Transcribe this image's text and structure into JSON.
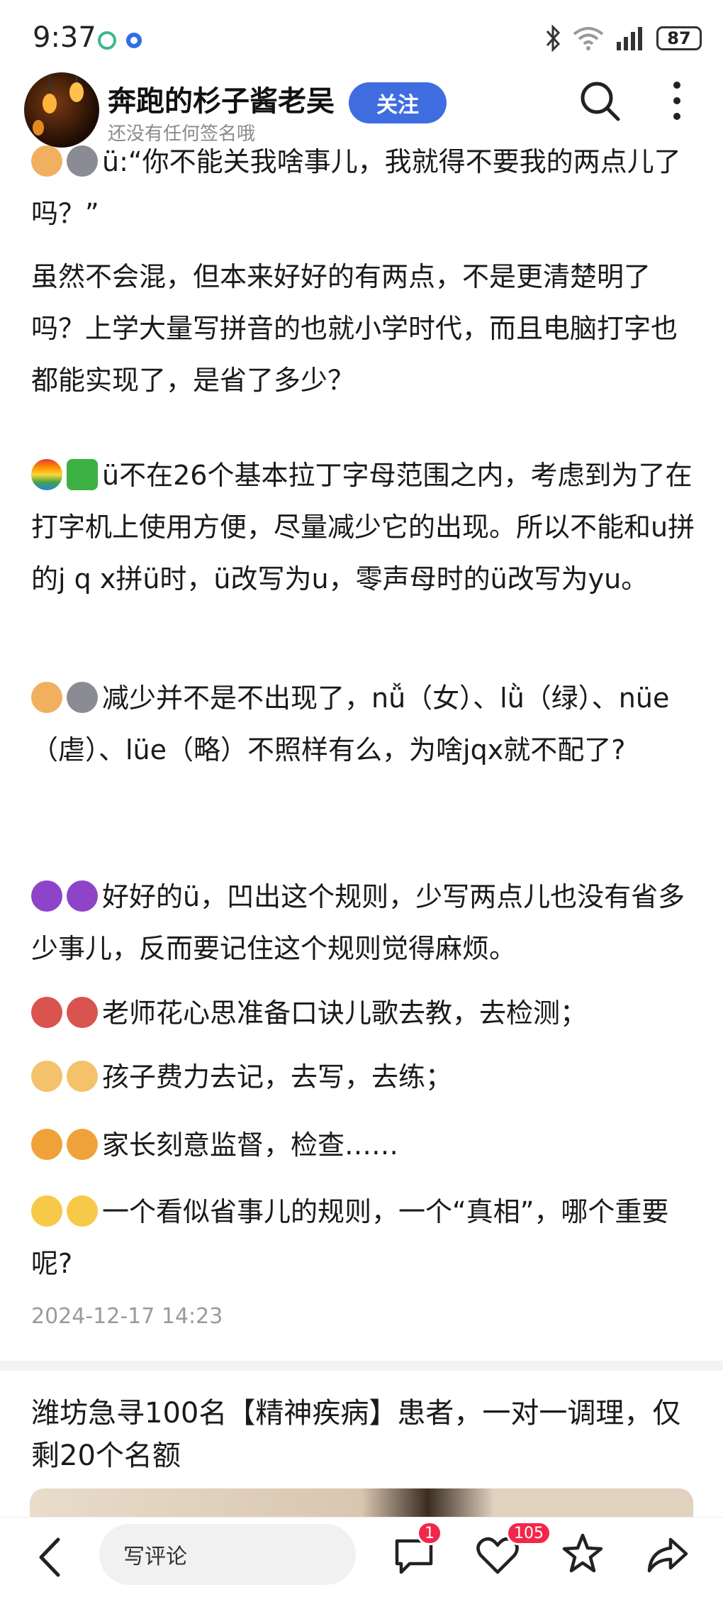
{
  "status": {
    "time": "9:37",
    "battery": "87"
  },
  "header": {
    "author": "奔跑的杉子酱老吴",
    "bio": "还没有任何签名哦",
    "follow_label": "关注"
  },
  "article": {
    "p1": "ü:“你不能关我啥事儿，我就得不要我的两点儿了吗？”",
    "p2": "虽然不会混，但本来好好的有两点，不是更清楚明了吗？上学大量写拼音的也就小学时代，而且电脑打字也都能实现了，是省了多少？",
    "p3": "ü不在26个基本拉丁字母范围之内，考虑到为了在打字机上使用方便，尽量减少它的出现。所以不能和u拼的j q x拼ü时，ü改写为u，零声母时的ü改写为yu。",
    "p4": "减少并不是不出现了，nǚ（女）、lǜ（绿）、nüe（虐）、lüe（略）不照样有么，为啥jqx就不配了?",
    "p5": "好好的ü，凹出这个规则，少写两点儿也没有省多少事儿，反而要记住这个规则觉得麻烦。",
    "p6": "老师花心思准备口诀儿歌去教，去检测；",
    "p7": "孩子费力去记，去写，去练；",
    "p8": "家长刻意监督，检查……",
    "p9": "一个看似省事儿的规则，一个“真相”，哪个重要呢?",
    "timestamp": "2024-12-17 14:23"
  },
  "ad": {
    "title": "潍坊急寻100名【精神疾病】患者，一对一调理，仅剩20个名额"
  },
  "bottom": {
    "comment_placeholder": "写评论",
    "comment_count": "1",
    "like_count": "105"
  },
  "colors": {
    "accent": "#3f6de0",
    "badge": "#f3274a"
  }
}
